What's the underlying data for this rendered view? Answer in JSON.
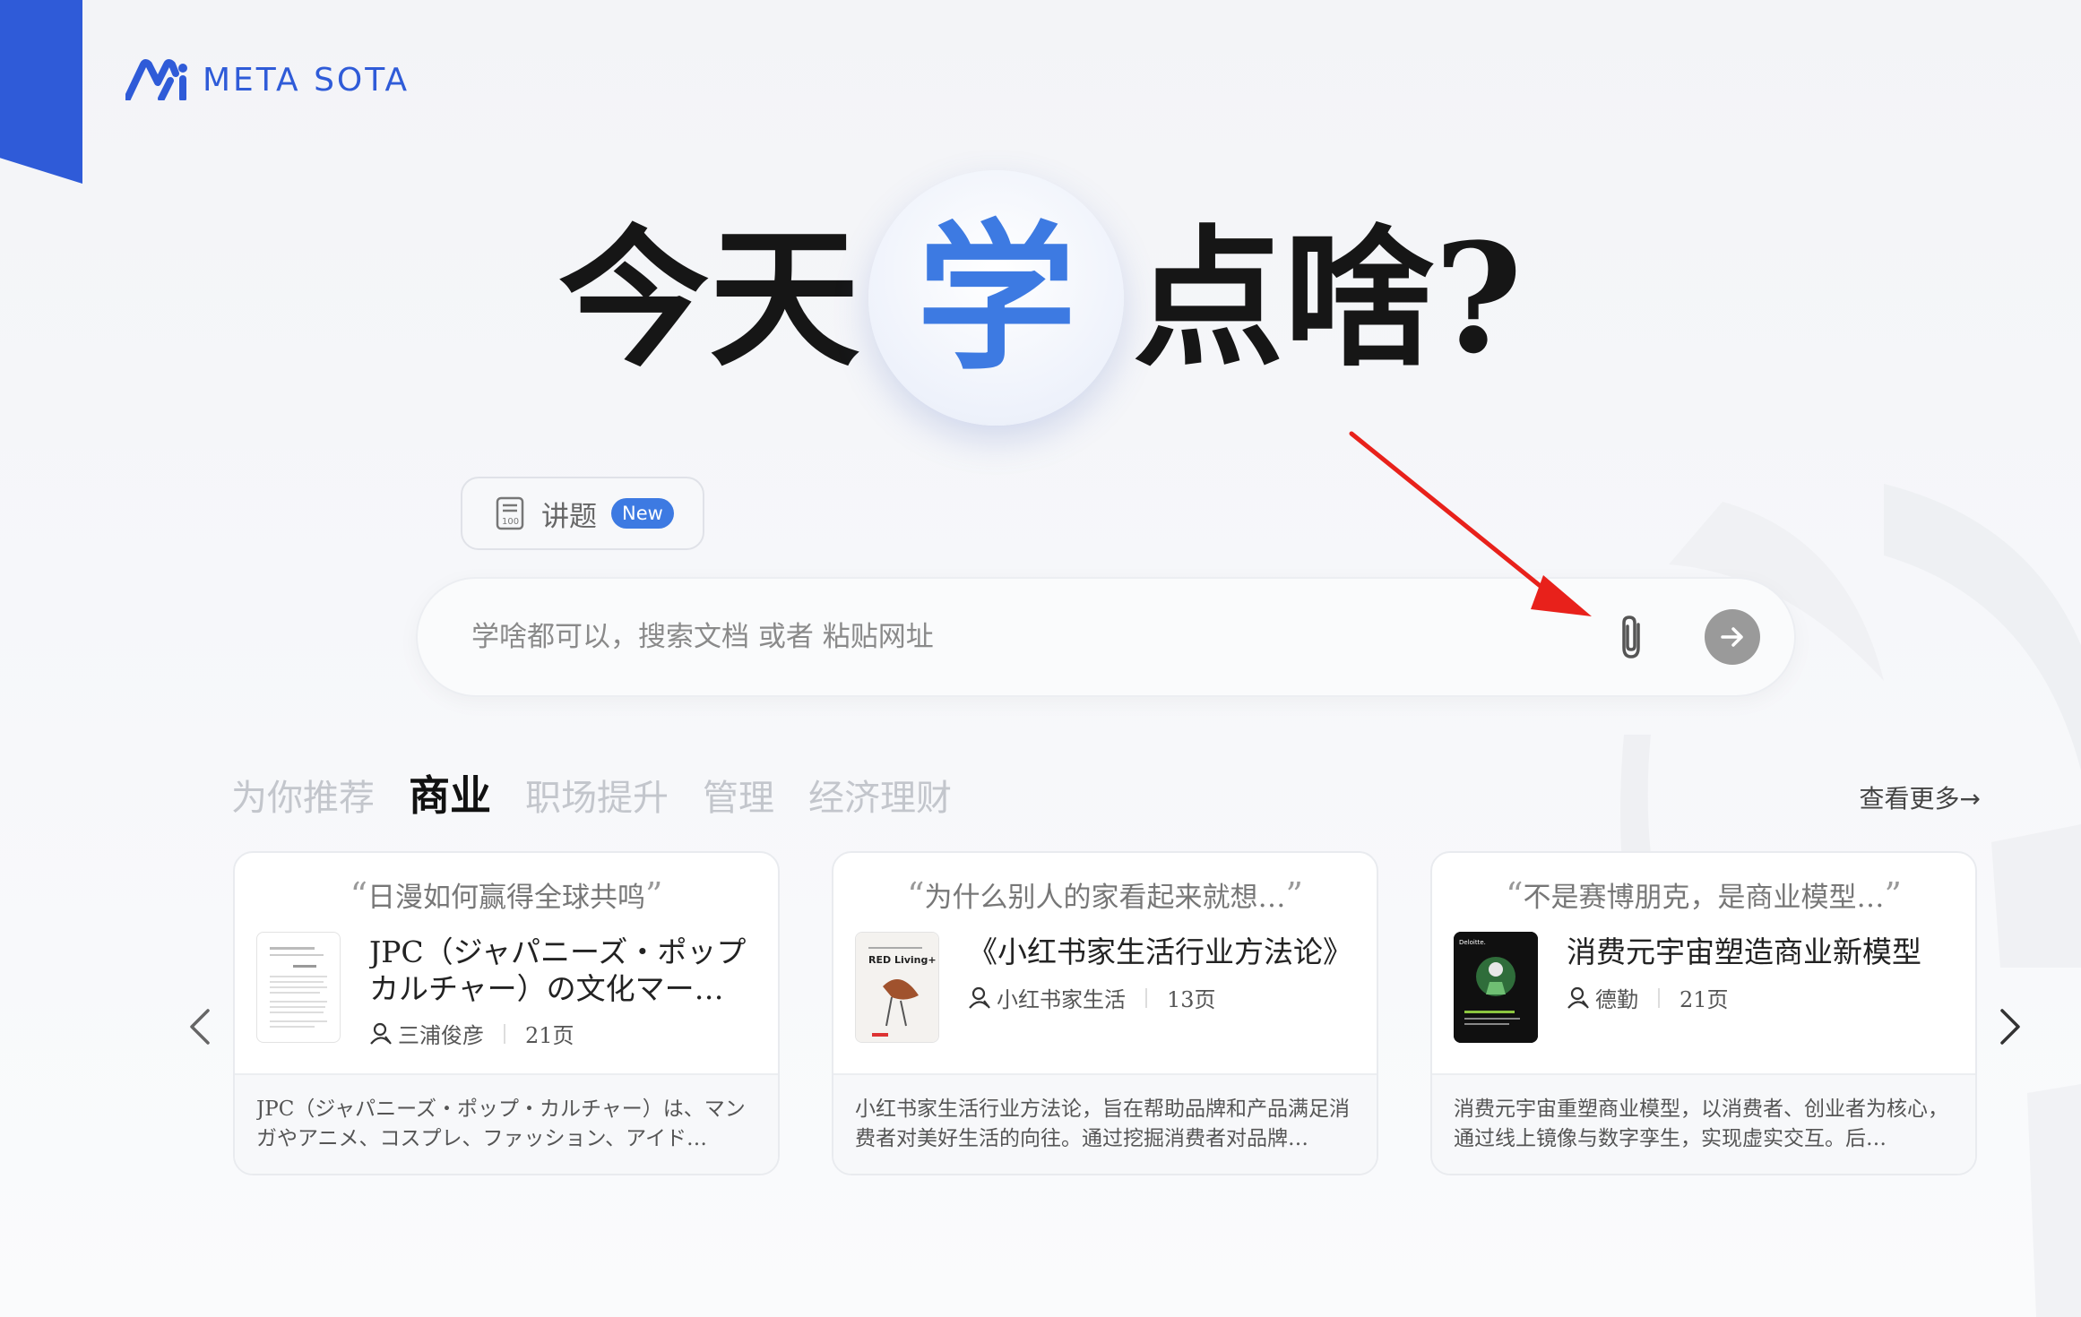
{
  "brand": {
    "name": "META SOTA",
    "accent": "#2f5bd8",
    "highlight": "#3d7ae2"
  },
  "hero": {
    "before": "今天",
    "highlight": "学",
    "after": "点啥?"
  },
  "mode_tab": {
    "label": "讲题",
    "badge": "New",
    "icon": "notebook-icon"
  },
  "search": {
    "placeholder": "学啥都可以，搜索文档 或者 粘贴网址",
    "value": "",
    "attach_icon": "paperclip-icon",
    "submit_icon": "arrow-right-icon"
  },
  "categories": [
    {
      "label": "为你推荐",
      "active": false
    },
    {
      "label": "商业",
      "active": true
    },
    {
      "label": "职场提升",
      "active": false
    },
    {
      "label": "管理",
      "active": false
    },
    {
      "label": "经济理财",
      "active": false
    }
  ],
  "see_more": "查看更多→",
  "cards": [
    {
      "question": "日漫如何赢得全球共鸣",
      "title": "JPC（ジャパニーズ・ポップカルチャー）の文化マーケ…",
      "author": "三浦俊彦",
      "pages": "21页",
      "description": "JPC（ジャパニーズ・ポップ・カルチャー）は、マンガやアニメ、コスプレ、ファッション、アイド…"
    },
    {
      "question": "为什么别人的家看起来就想…",
      "title": "《小红书家生活行业方法论》",
      "author": "小红书家生活",
      "pages": "13页",
      "description": "小红书家生活行业方法论，旨在帮助品牌和产品满足消费者对美好生活的向往。通过挖掘消费者对品牌…",
      "thumb_text": "RED Living+"
    },
    {
      "question": "不是赛博朋克，是商业模型…",
      "title": "消费元宇宙塑造商业新模型",
      "author": "德勤",
      "pages": "21页",
      "description": "消费元宇宙重塑商业模型，以消费者、创业者为核心，通过线上镜像与数字孪生，实现虚实交互。后…",
      "thumb_text": "Deloitte."
    }
  ]
}
